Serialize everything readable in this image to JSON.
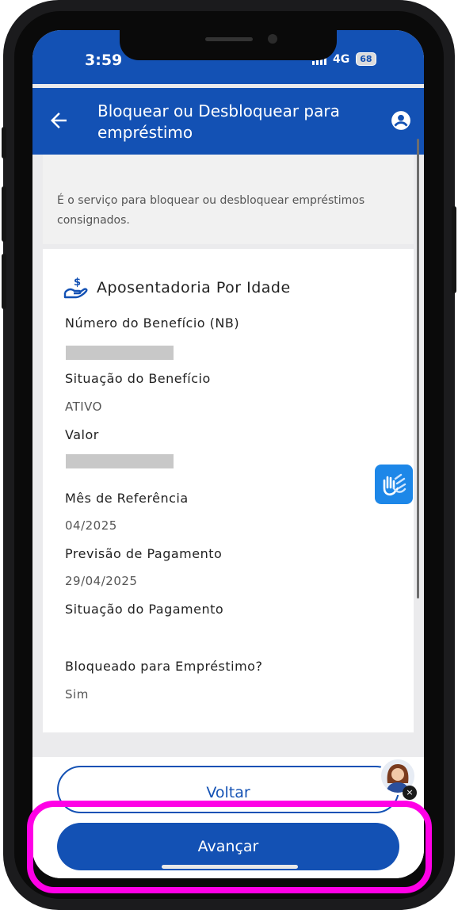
{
  "status_bar": {
    "time": "3:59",
    "network": "4G",
    "battery": "68"
  },
  "header": {
    "title": "Bloquear ou Desbloquear para empréstimo",
    "back_icon": "arrow-left-icon",
    "user_icon": "account-circle-icon"
  },
  "intro": {
    "text": "É o serviço para bloquear ou desbloquear empréstimos consignados."
  },
  "benefit": {
    "title": "Aposentadoria Por Idade",
    "icon": "hand-money-icon",
    "fields": [
      {
        "label": "Número do Benefício (NB)",
        "value": ""
      },
      {
        "label": "Situação do Benefício",
        "value": "ATIVO"
      },
      {
        "label": "Valor",
        "value": ""
      },
      {
        "label": "Mês de Referência",
        "value": "04/2025"
      },
      {
        "label": "Previsão de Pagamento",
        "value": "29/04/2025"
      },
      {
        "label": "Situação do Pagamento",
        "value": ""
      },
      {
        "label": "Bloqueado para Empréstimo?",
        "value": "Sim"
      }
    ]
  },
  "buttons": {
    "voltar": "Voltar",
    "avancar": "Avançar"
  },
  "floating": {
    "libras_icon": "sign-language-icon",
    "assistant_icon": "assistant-avatar-icon",
    "close_icon": "close-icon",
    "close_glyph": "×"
  },
  "colors": {
    "primary": "#1351b4",
    "highlight": "#ff00e6",
    "libras": "#1d87e8"
  }
}
